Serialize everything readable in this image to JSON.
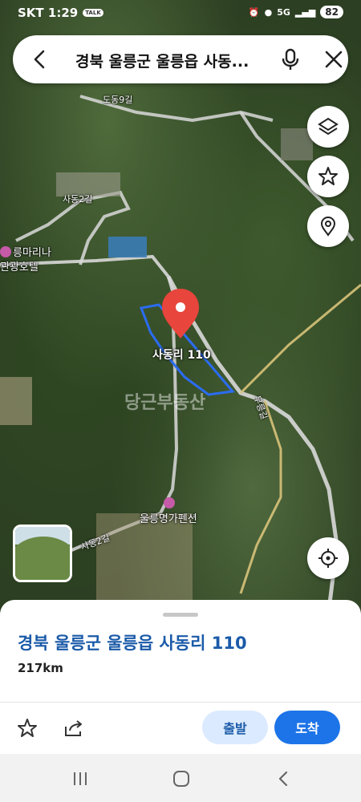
{
  "status_bar": {
    "carrier_time": "SKT 1:29",
    "talk_badge": "TALK",
    "network": "5G",
    "battery": "82"
  },
  "search": {
    "query": "경북 울릉군 울릉읍 사동..."
  },
  "map": {
    "road_labels": [
      "도동9길",
      "사동2길",
      "무릉길",
      "사동2길"
    ],
    "poi_labels": [
      "릉마리나",
      "관광호텔",
      "울릉명가펜션"
    ],
    "pin_label": "사동리 110",
    "watermark": "당근부동산"
  },
  "sheet": {
    "title": "경북 울릉군 울릉읍 사동리 110",
    "distance": "217km"
  },
  "actions": {
    "depart": "출발",
    "arrive": "도착"
  },
  "icons": [
    "back-arrow-icon",
    "microphone-icon",
    "close-icon",
    "layers-icon",
    "star-icon",
    "location-pin-icon",
    "my-location-icon",
    "share-icon",
    "recent-apps-icon",
    "home-icon",
    "nav-back-icon"
  ],
  "colors": {
    "accent": "#1d74e8",
    "title": "#1a5aa8",
    "pin": "#e8453c",
    "parcel": "#2b6cf0"
  }
}
